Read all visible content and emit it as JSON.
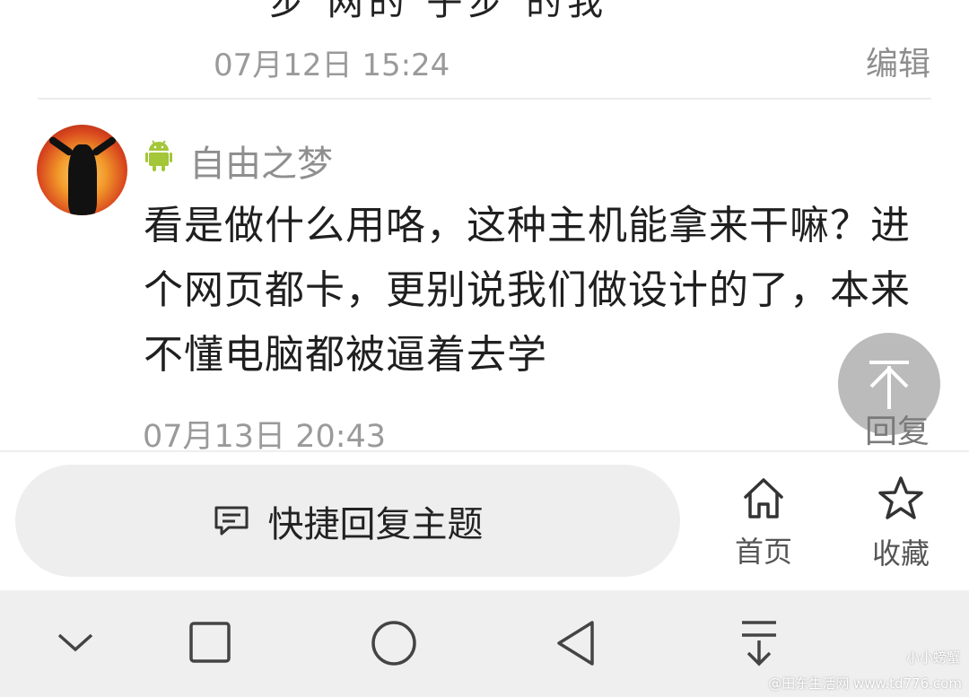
{
  "previous_post": {
    "cut_text": "步    网的    子步     的我",
    "time": "07月12日 15:24",
    "edit_label": "编辑"
  },
  "post": {
    "username": "自由之梦",
    "platform_icon": "android-icon",
    "content": "看是做什么用咯，这种主机能拿来干嘛？进个网页都卡，更别说我们做设计的了，本来不懂电脑都被逼着去学",
    "time": "07月13日 20:43"
  },
  "floating_reply": {
    "label": "回复",
    "icon": "arrow-up-to-top-icon"
  },
  "bottom_bar": {
    "quick_reply_label": "快捷回复主题",
    "quick_reply_icon": "comment-icon",
    "home_label": "首页",
    "favorite_label": "收藏"
  },
  "system_nav": {
    "buttons": [
      "chevron-down-icon",
      "recents-square-icon",
      "home-circle-icon",
      "back-triangle-icon",
      "notification-pull-icon"
    ]
  },
  "watermark": {
    "line1": "小小螃蟹",
    "line2": "@田东生活网 www.td776.com"
  },
  "colors": {
    "android_green": "#a4c639",
    "secondary_text": "#9a9a9a",
    "fab_gray": "#b8b8b8"
  }
}
